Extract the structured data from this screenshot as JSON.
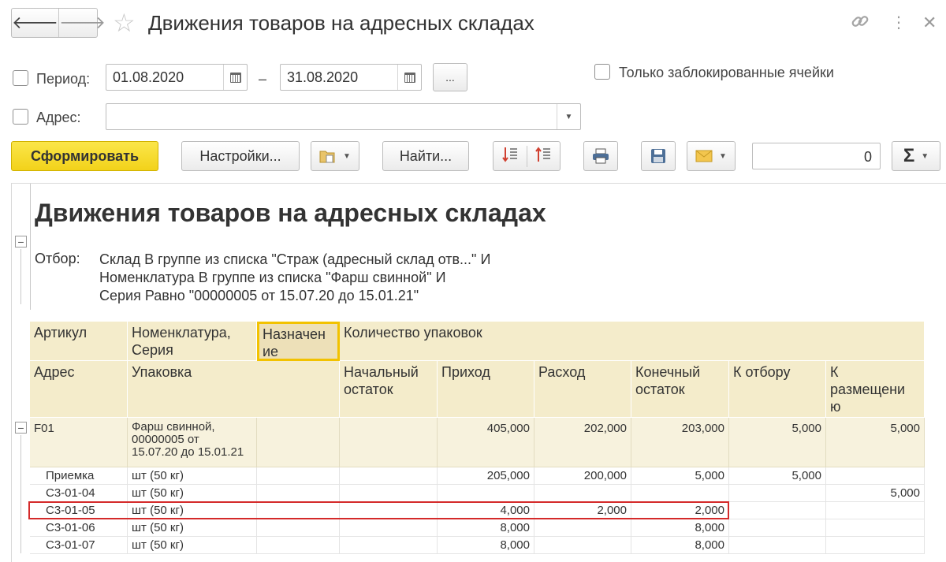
{
  "window": {
    "title": "Движения товаров на адресных складах",
    "back_icon": "arrow-left-icon",
    "forward_icon": "arrow-right-icon",
    "star_icon": "star-icon",
    "link_icon": "link-icon",
    "menu_icon": "more-icon",
    "close_icon": "close-icon"
  },
  "filters": {
    "period_label": "Период:",
    "date_from": "01.08.2020",
    "date_sep": "–",
    "date_to": "31.08.2020",
    "choose_period_label": "...",
    "only_locked_label": "Только заблокированные ячейки",
    "address_label": "Адрес:",
    "address_value": ""
  },
  "toolbar": {
    "generate_label": "Сформировать",
    "settings_label": "Настройки...",
    "find_label": "Найти...",
    "sum_value": "0",
    "sum_icon": "Σ"
  },
  "report": {
    "title": "Движения товаров на адресных складах",
    "filter_label": "Отбор:",
    "filter_lines": [
      "Склад В группе из списка \"Страж (адресный склад отв...\" И",
      "Номенклатура В группе из списка \"Фарш свинной\" И",
      "Серия Равно \"00000005 от 15.07.20 до 15.01.21\""
    ],
    "headers": {
      "article": "Артикул",
      "nomenclature_line1": "Номенклатура,",
      "nomenclature_line2": "Серия",
      "purpose_line1": "Назначен",
      "purpose_line2": "ие",
      "qty_packages": "Количество упаковок",
      "address": "Адрес",
      "package": "Упаковка",
      "start_line1": "Начальный",
      "start_line2": "остаток",
      "income": "Приход",
      "expense": "Расход",
      "end_line1": "Конечный",
      "end_line2": "остаток",
      "to_pick": "К отбору",
      "to_place_line1": "К",
      "to_place_line2": "размещени",
      "to_place_line3": "ю"
    },
    "group": {
      "code": "F01",
      "nomenclature_line1": "Фарш свинной,",
      "nomenclature_line2": "00000005 от",
      "nomenclature_line3": "15.07.20 до 15.01.21",
      "start": "",
      "income": "405,000",
      "expense": "202,000",
      "end": "203,000",
      "to_pick": "5,000",
      "to_place": "5,000"
    },
    "rows": [
      {
        "address": "Приемка",
        "package": "шт (50 кг)",
        "start": "",
        "income": "205,000",
        "expense": "200,000",
        "end": "5,000",
        "to_pick": "5,000",
        "to_place": ""
      },
      {
        "address": "С3-01-04",
        "package": "шт (50 кг)",
        "start": "",
        "income": "",
        "expense": "",
        "end": "",
        "to_pick": "",
        "to_place": "5,000"
      },
      {
        "address": "С3-01-05",
        "package": "шт (50 кг)",
        "start": "",
        "income": "4,000",
        "expense": "2,000",
        "end": "2,000",
        "to_pick": "",
        "to_place": ""
      },
      {
        "address": "С3-01-06",
        "package": "шт (50 кг)",
        "start": "",
        "income": "8,000",
        "expense": "",
        "end": "8,000",
        "to_pick": "",
        "to_place": ""
      },
      {
        "address": "С3-01-07",
        "package": "шт (50 кг)",
        "start": "",
        "income": "8,000",
        "expense": "",
        "end": "8,000",
        "to_pick": "",
        "to_place": ""
      }
    ]
  },
  "colors": {
    "header_bg": "#f4eccb",
    "primary_button": "#f2d21a",
    "highlight_border": "#d42a2a",
    "selected_cell_border": "#f2c200"
  }
}
